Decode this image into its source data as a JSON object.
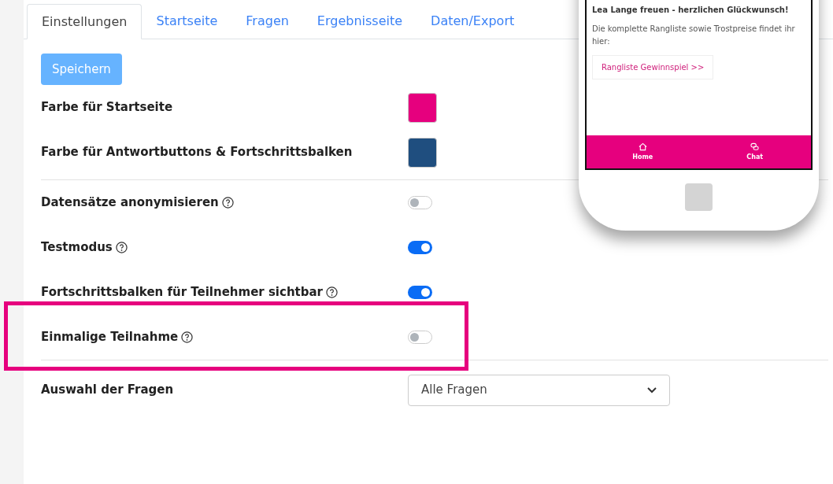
{
  "tabs": [
    {
      "label": "Einstellungen",
      "selected": true
    },
    {
      "label": "Startseite",
      "selected": false
    },
    {
      "label": "Fragen",
      "selected": false
    },
    {
      "label": "Ergebnisseite",
      "selected": false
    },
    {
      "label": "Daten/Export",
      "selected": false
    }
  ],
  "save_button": "Speichern",
  "colors": [
    {
      "label": "Farbe für Startseite",
      "color": "#e6007e"
    },
    {
      "label": "Farbe für Antwortbuttons & Fortschrittsbalken",
      "color": "#1f4e7f"
    }
  ],
  "switches": [
    {
      "label": "Datensätze anonymisieren",
      "on": false,
      "highlighted": false
    },
    {
      "label": "Testmodus",
      "on": true,
      "highlighted": false
    },
    {
      "label": "Fortschrittsbalken für Teilnehmer sichtbar",
      "on": true,
      "highlighted": false
    },
    {
      "label": "Einmalige Teilnahme",
      "on": false,
      "highlighted": true
    }
  ],
  "question_select": {
    "label": "Auswahl der Fragen",
    "value": "Alle Fragen"
  },
  "phone_preview": {
    "message": "Lea Lange freuen - herzlichen Glückwunsch!",
    "note": "Die komplette Rangliste sowie Trostpreise findet ihr hier:",
    "link": "Rangliste Gewinnspiel >>",
    "nav": [
      {
        "label": "Home",
        "kind": "home"
      },
      {
        "label": "Chat",
        "kind": "chat"
      }
    ]
  }
}
